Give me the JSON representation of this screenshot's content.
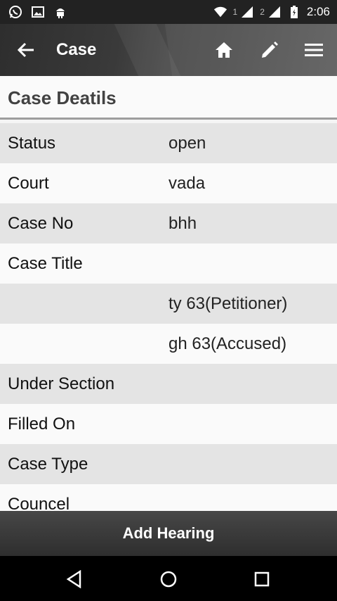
{
  "status_bar": {
    "time": "2:06",
    "sim1": "1",
    "sim2": "2",
    "icons": [
      "whatsapp-icon",
      "image-icon",
      "android-icon",
      "wifi-icon",
      "signal-icon",
      "signal-icon",
      "battery-charging-icon"
    ]
  },
  "toolbar": {
    "title": "Case",
    "icons": [
      "back-arrow-icon",
      "home-icon",
      "edit-pencil-icon",
      "menu-icon"
    ]
  },
  "section": {
    "title": "Case Deatils"
  },
  "rows": [
    {
      "label": "Status",
      "value": "open"
    },
    {
      "label": "Court",
      "value": "vada"
    },
    {
      "label": "Case No",
      "value": "bhh"
    },
    {
      "label": "Case Title",
      "value": ""
    },
    {
      "label": "",
      "value": "ty 63(Petitioner)"
    },
    {
      "label": "",
      "value": "gh 63(Accused)"
    },
    {
      "label": "Under Section",
      "value": ""
    },
    {
      "label": "Filled On",
      "value": ""
    },
    {
      "label": "Case Type",
      "value": ""
    },
    {
      "label": "Councel",
      "value": ""
    }
  ],
  "add_button": {
    "label": "Add Hearing"
  },
  "nav_bar": {
    "icons": [
      "back-triangle-icon",
      "home-circle-icon",
      "recents-square-icon"
    ]
  },
  "colors": {
    "toolbar_dark": "#2e2e2e",
    "row_shaded": "#e4e4e4",
    "row_light": "#fafafa",
    "section_text": "#424242"
  }
}
